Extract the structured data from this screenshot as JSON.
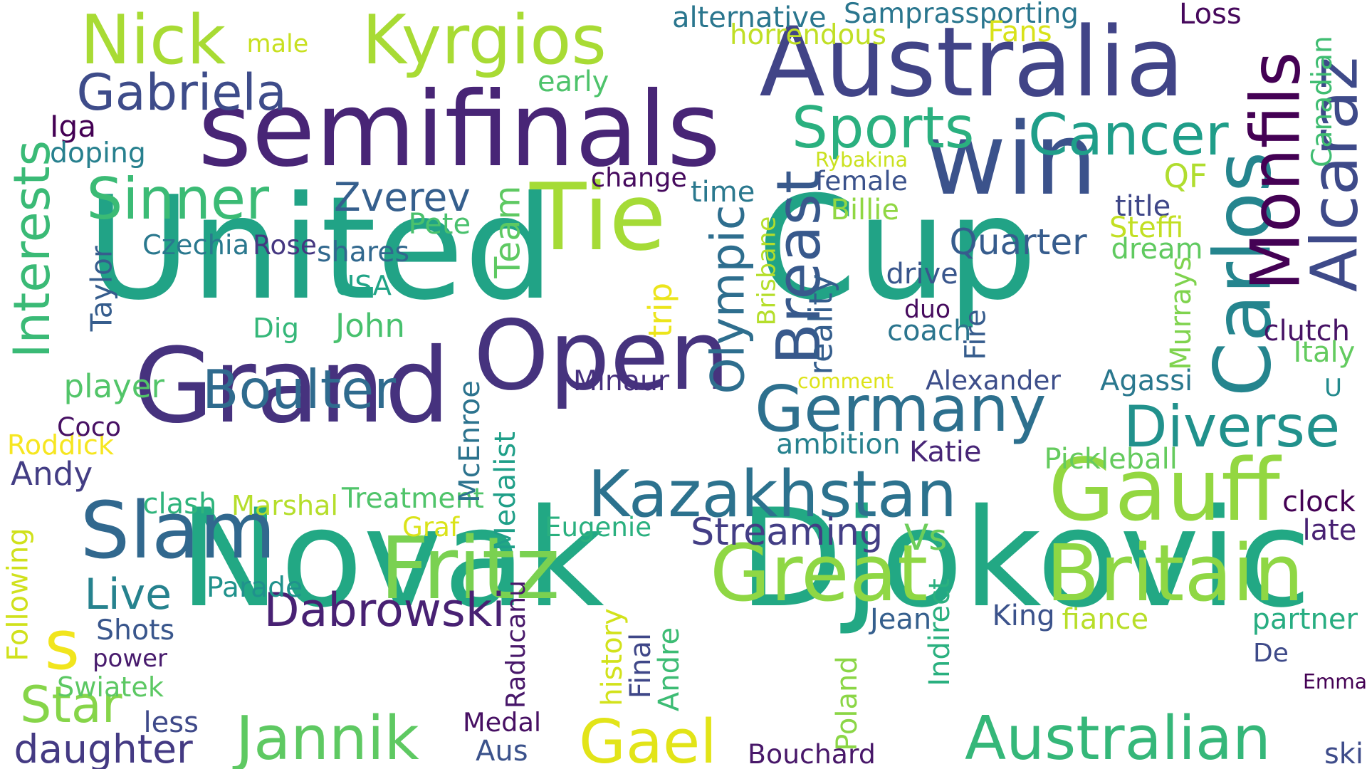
{
  "cloud": {
    "words": [
      {
        "text": "United",
        "color": "#21a386"
      },
      {
        "text": "Cup",
        "color": "#21a386"
      },
      {
        "text": "Novak",
        "color": "#22a884"
      },
      {
        "text": "Djokovic",
        "color": "#22a884"
      },
      {
        "text": "Australia",
        "color": "#414487"
      },
      {
        "text": "semifinals",
        "color": "#482576"
      },
      {
        "text": "win",
        "color": "#3b528b"
      },
      {
        "text": "Open",
        "color": "#46337e"
      },
      {
        "text": "Grand",
        "color": "#46327e"
      },
      {
        "text": "Slam",
        "color": "#31688e"
      },
      {
        "text": "Tie",
        "color": "#a5db36"
      },
      {
        "text": "Fritz",
        "color": "#7ad151"
      },
      {
        "text": "Great",
        "color": "#8fd744"
      },
      {
        "text": "Britain",
        "color": "#8fd744"
      },
      {
        "text": "Gauff",
        "color": "#93d741"
      },
      {
        "text": "Australian",
        "color": "#35b779"
      },
      {
        "text": "Jannik",
        "color": "#5ec962"
      },
      {
        "text": "Nick",
        "color": "#a8db34"
      },
      {
        "text": "Kyrgios",
        "color": "#a8db34"
      },
      {
        "text": "Sports",
        "color": "#2ab07f"
      },
      {
        "text": "Cancer",
        "color": "#1f9e89"
      },
      {
        "text": "Carlos",
        "color": "#25858e"
      },
      {
        "text": "Monfils",
        "color": "#440154"
      },
      {
        "text": "Alcaraz",
        "color": "#3e4a89"
      },
      {
        "text": "Germany",
        "color": "#2d708e"
      },
      {
        "text": "Kazakhstan",
        "color": "#2c728e"
      },
      {
        "text": "Diverse",
        "color": "#21918c"
      },
      {
        "text": "Boulter",
        "color": "#2f6b8e"
      },
      {
        "text": "Sinner",
        "color": "#3bbb75"
      },
      {
        "text": "Gabriela",
        "color": "#3e4c8a"
      },
      {
        "text": "Interests",
        "color": "#3aba76"
      },
      {
        "text": "Breast",
        "color": "#38598c"
      },
      {
        "text": "Olympic",
        "color": "#2e6e8e"
      },
      {
        "text": "Gael",
        "color": "#e2e418"
      },
      {
        "text": "Star",
        "color": "#86d549"
      },
      {
        "text": "s",
        "color": "#f1e51d"
      },
      {
        "text": "Dabrowski",
        "color": "#482173"
      },
      {
        "text": "Live",
        "color": "#26828e"
      },
      {
        "text": "Streaming",
        "color": "#433e85"
      },
      {
        "text": "Zverev",
        "color": "#355f8d"
      },
      {
        "text": "Quarter",
        "color": "#365c8d"
      },
      {
        "text": "Team",
        "color": "#5ec962"
      },
      {
        "text": "Vs",
        "color": "#6ccd5a"
      },
      {
        "text": "daughter",
        "color": "#443a83"
      },
      {
        "text": "Andy",
        "color": "#433d84"
      },
      {
        "text": "player",
        "color": "#52c569"
      },
      {
        "text": "Roddick",
        "color": "#f6e620"
      },
      {
        "text": "Coco",
        "color": "#471063"
      },
      {
        "text": "clash",
        "color": "#2fb47c"
      },
      {
        "text": "Marshal",
        "color": "#b5de2b"
      },
      {
        "text": "Treatment",
        "color": "#50c46a"
      },
      {
        "text": "Parade",
        "color": "#20928c"
      },
      {
        "text": "Shots",
        "color": "#39568c"
      },
      {
        "text": "power",
        "color": "#481b6d"
      },
      {
        "text": "Swiatek",
        "color": "#5cc863"
      },
      {
        "text": "less",
        "color": "#3e4989"
      },
      {
        "text": "Following",
        "color": "#d0e11c"
      },
      {
        "text": "Taylor",
        "color": "#365d8d"
      },
      {
        "text": "Dig",
        "color": "#35b779"
      },
      {
        "text": "John",
        "color": "#48c16e"
      },
      {
        "text": "USA",
        "color": "#20a486"
      },
      {
        "text": "Czechia",
        "color": "#2a788e"
      },
      {
        "text": "Rose",
        "color": "#453781"
      },
      {
        "text": "shares",
        "color": "#31688e"
      },
      {
        "text": "Pete",
        "color": "#4ac16d"
      },
      {
        "text": "Iga",
        "color": "#440154"
      },
      {
        "text": "doping",
        "color": "#27808e"
      },
      {
        "text": "male",
        "color": "#c8e020"
      },
      {
        "text": "early",
        "color": "#4ec36b"
      },
      {
        "text": "alternative",
        "color": "#2a768e"
      },
      {
        "text": "Samprassporting",
        "color": "#2a768e"
      },
      {
        "text": "horrendous",
        "color": "#c0df25"
      },
      {
        "text": "Fans",
        "color": "#d8e219"
      },
      {
        "text": "Loss",
        "color": "#46085c"
      },
      {
        "text": "Canadian",
        "color": "#40bd72"
      },
      {
        "text": "Rybakina",
        "color": "#cae11f"
      },
      {
        "text": "female",
        "color": "#3b528b"
      },
      {
        "text": "Billie",
        "color": "#90d743"
      },
      {
        "text": "change",
        "color": "#460b5e"
      },
      {
        "text": "time",
        "color": "#2a788e"
      },
      {
        "text": "QF",
        "color": "#b0dd2f"
      },
      {
        "text": "title",
        "color": "#3f4788"
      },
      {
        "text": "Steffi",
        "color": "#c2df23"
      },
      {
        "text": "dream",
        "color": "#60ca60"
      },
      {
        "text": "Murrays",
        "color": "#7fd34e"
      },
      {
        "text": "drive",
        "color": "#39568c"
      },
      {
        "text": "duo",
        "color": "#460b5e"
      },
      {
        "text": "coach",
        "color": "#2b758e"
      },
      {
        "text": "Fire",
        "color": "#365c8d"
      },
      {
        "text": "clutch",
        "color": "#471365"
      },
      {
        "text": "Italy",
        "color": "#63cb5f"
      },
      {
        "text": "comment",
        "color": "#dde318"
      },
      {
        "text": "Alexander",
        "color": "#3d4e8a"
      },
      {
        "text": "Agassi",
        "color": "#2a788e"
      },
      {
        "text": "U",
        "color": "#238a8d"
      },
      {
        "text": "Brisbane",
        "color": "#b5de2b"
      },
      {
        "text": "reality",
        "color": "#355e8d"
      },
      {
        "text": "trip",
        "color": "#ece51b"
      },
      {
        "text": "Minaur",
        "color": "#46307e"
      },
      {
        "text": "ambition",
        "color": "#26818e"
      },
      {
        "text": "Katie",
        "color": "#482677"
      },
      {
        "text": "Pickleball",
        "color": "#65cb5e"
      },
      {
        "text": "McEnroe",
        "color": "#2c738e"
      },
      {
        "text": "Medalist",
        "color": "#1f9f88"
      },
      {
        "text": "Graf",
        "color": "#dae319"
      },
      {
        "text": "Eugenie",
        "color": "#2ab07f"
      },
      {
        "text": "clock",
        "color": "#440154"
      },
      {
        "text": "late",
        "color": "#482173"
      },
      {
        "text": "Raducanu",
        "color": "#48186a"
      },
      {
        "text": "history",
        "color": "#d2e21b"
      },
      {
        "text": "Final",
        "color": "#3f4788"
      },
      {
        "text": "Andre",
        "color": "#3dbc74"
      },
      {
        "text": "Indirect",
        "color": "#2ab07f"
      },
      {
        "text": "Jean",
        "color": "#355f8d"
      },
      {
        "text": "King",
        "color": "#3b528b"
      },
      {
        "text": "fiance",
        "color": "#b8de29"
      },
      {
        "text": "partner",
        "color": "#27ad81"
      },
      {
        "text": "De",
        "color": "#3e4a89"
      },
      {
        "text": "Emma",
        "color": "#440154"
      },
      {
        "text": "Poland",
        "color": "#8bd646"
      },
      {
        "text": "Medal",
        "color": "#471063"
      },
      {
        "text": "Aus",
        "color": "#3b528b"
      },
      {
        "text": "Bouchard",
        "color": "#481769"
      },
      {
        "text": "ski",
        "color": "#3e4c8a"
      }
    ]
  }
}
